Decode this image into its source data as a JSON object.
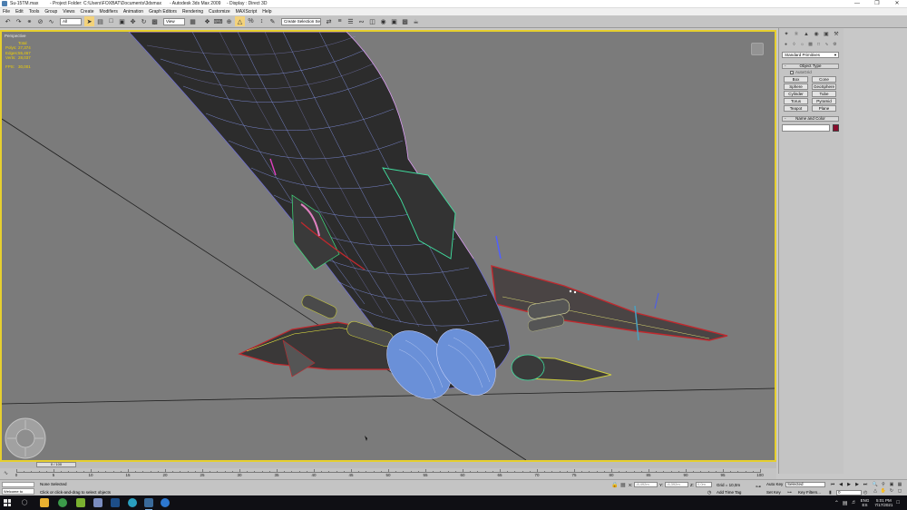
{
  "titlebar": {
    "file": "Su-15TM.max",
    "project": "- Project Folder: C:\\Users\\FOXBAT\\Documents\\3dsmax",
    "app": "- Autodesk 3ds Max 2009",
    "display": "- Display : Direct 3D",
    "controls": [
      "—",
      "❐",
      "✕"
    ]
  },
  "menu": [
    "File",
    "Edit",
    "Tools",
    "Group",
    "Views",
    "Create",
    "Modifiers",
    "Animation",
    "Graph Editors",
    "Rendering",
    "Customize",
    "MAXScript",
    "Help"
  ],
  "toolbar": {
    "filter_value": "All",
    "coord_value": "View",
    "named_sel_value": "Create Selection Set"
  },
  "viewport": {
    "label": "Perspective",
    "stats": [
      {
        "k": "",
        "v": "Total"
      },
      {
        "k": "Polys:",
        "v": "27,374"
      },
      {
        "k": "Edges:",
        "v": "55,467"
      },
      {
        "k": "Verts:",
        "v": "28,037"
      },
      {
        "k": "",
        "v": ""
      },
      {
        "k": "FPS:",
        "v": "30,001"
      }
    ]
  },
  "command_panel": {
    "tabs": [
      "create-tab",
      "modify-tab",
      "hierarchy-tab",
      "motion-tab",
      "display-tab",
      "utilities-tab"
    ],
    "primitive_type": "Standard Primitives",
    "object_type_title": "Object Type",
    "autogrid": "AutoGrid",
    "objects": [
      "Box",
      "Cone",
      "Sphere",
      "GeoSphere",
      "Cylinder",
      "Tube",
      "Torus",
      "Pyramid",
      "Teapot",
      "Plane"
    ],
    "name_color_title": "Name and Color",
    "object_color": "#8a0c2c"
  },
  "timeline": {
    "slider_label": "0 / 100",
    "ticks": [
      "0",
      "5",
      "10",
      "15",
      "20",
      "25",
      "30",
      "35",
      "40",
      "45",
      "50",
      "55",
      "60",
      "65",
      "70",
      "75",
      "80",
      "85",
      "90",
      "95",
      "100"
    ]
  },
  "status": {
    "maxscript": "Welcome to",
    "selection": "None Selected",
    "prompt": "Click or click-and-drag to select objects",
    "x_label": "X:",
    "x_value": "-8,492m",
    "y_label": "Y:",
    "y_value": "-6,392m",
    "z_label": "Z:",
    "z_value": "0,0m",
    "grid": "Grid = 10,0m",
    "add_time_tag": "Add Time Tag",
    "auto_key": "Auto Key",
    "set_key": "Set Key",
    "selected_dropdown": "Selected",
    "key_filters": "Key Filters...",
    "frame": "0"
  },
  "taskbar": {
    "lang_top": "ENG",
    "lang_bottom": "ES",
    "time": "5:01 PM",
    "date": "7/17/2021"
  }
}
